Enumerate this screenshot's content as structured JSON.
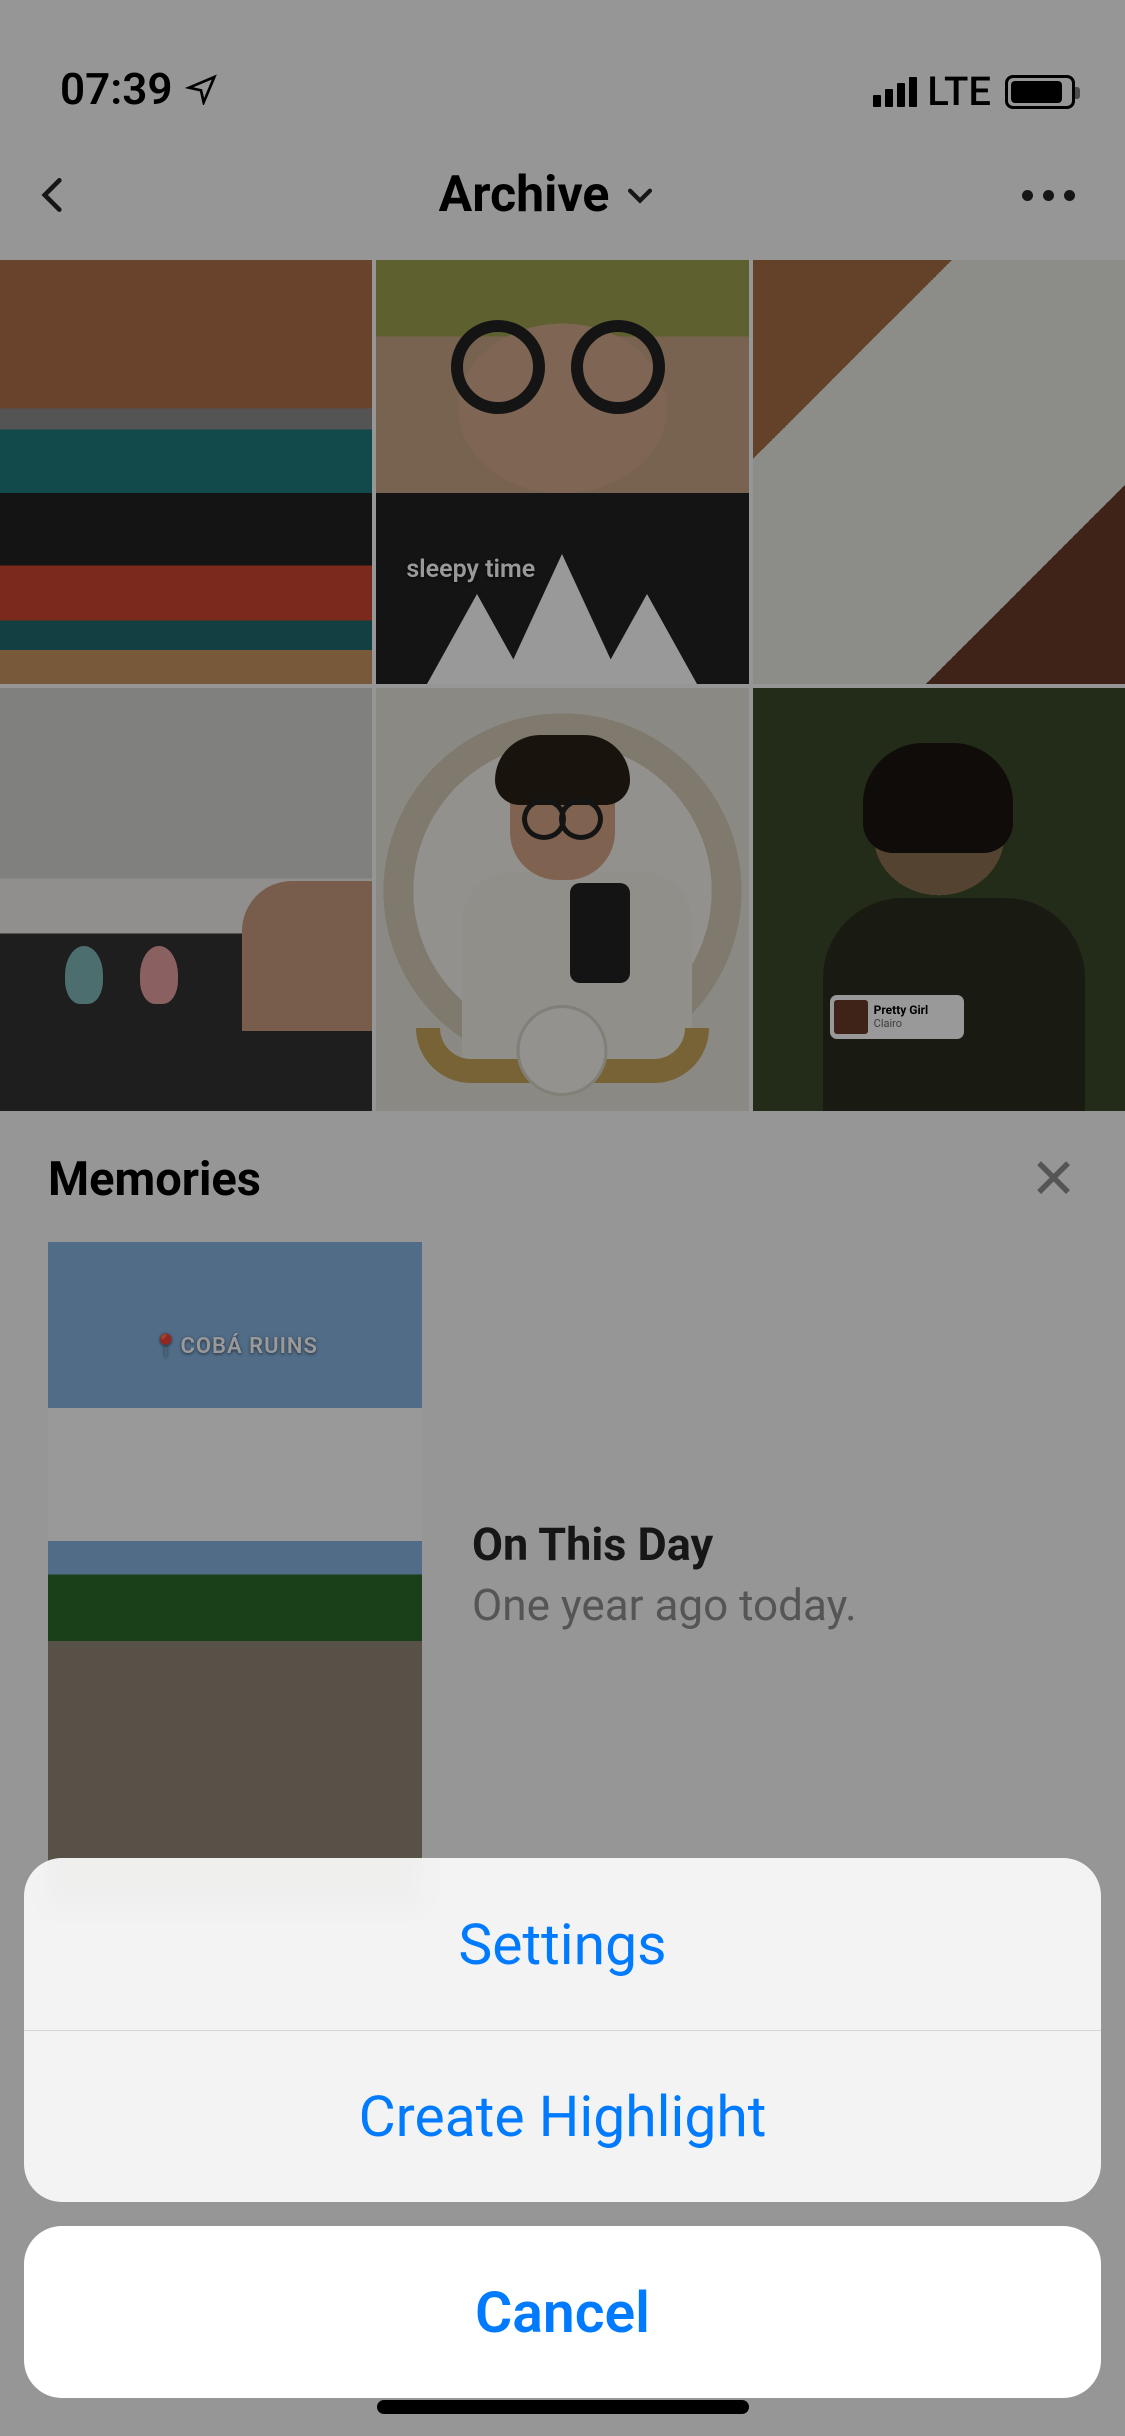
{
  "status": {
    "time": "07:39",
    "network": "LTE"
  },
  "nav": {
    "title": "Archive"
  },
  "grid": {
    "items": [
      {
        "caption": ""
      },
      {
        "caption": "sleepy time"
      },
      {
        "caption": ""
      },
      {
        "caption": ""
      },
      {
        "caption": ""
      },
      {
        "caption": "",
        "music": {
          "title": "Pretty Girl",
          "artist": "Clairo"
        }
      }
    ]
  },
  "memories": {
    "heading": "Memories",
    "location_tag": "COBÁ RUINS",
    "on_this_day": {
      "title": "On This Day",
      "subtitle": "One year ago today."
    }
  },
  "sheet": {
    "settings": "Settings",
    "create_highlight": "Create Highlight",
    "cancel": "Cancel"
  }
}
